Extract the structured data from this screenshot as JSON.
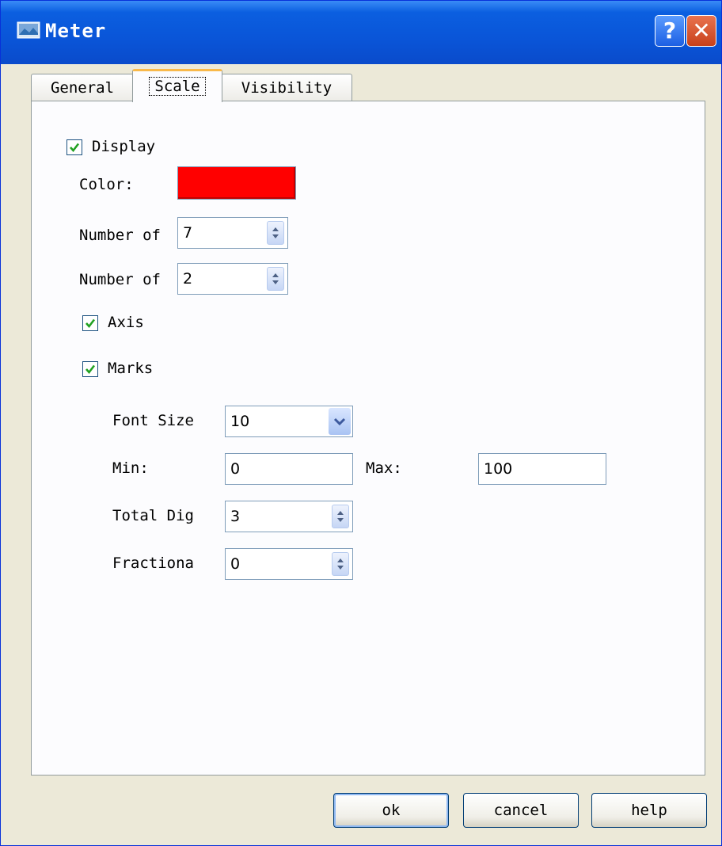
{
  "window": {
    "title": "Meter"
  },
  "tabs": [
    {
      "label": "General",
      "selected": false
    },
    {
      "label": "Scale",
      "selected": true
    },
    {
      "label": "Visibility",
      "selected": false
    }
  ],
  "scale": {
    "display": {
      "label": "Display",
      "checked": true
    },
    "color": {
      "label": "Color:",
      "value": "#ff0000"
    },
    "number1": {
      "label": "Number of",
      "value": "7"
    },
    "number2": {
      "label": "Number of",
      "value": "2"
    },
    "axis": {
      "label": "Axis",
      "checked": true
    },
    "marks": {
      "label": "Marks",
      "checked": true
    },
    "font_size": {
      "label": "Font Size",
      "value": "10"
    },
    "min": {
      "label": "Min:",
      "value": "0"
    },
    "max": {
      "label": "Max:",
      "value": "100"
    },
    "total_digits": {
      "label": "Total Dig",
      "value": "3"
    },
    "fractional": {
      "label": "Fractiona",
      "value": "0"
    }
  },
  "buttons": {
    "ok": "ok",
    "cancel": "cancel",
    "help": "help"
  },
  "colors": {
    "titlebar": "#0a55d8",
    "dialog_bg": "#ece9d8",
    "accent_tab": "#f9b94a"
  },
  "icons": {
    "title": "meter-window-icon",
    "help": "help-icon",
    "close": "close-icon"
  }
}
